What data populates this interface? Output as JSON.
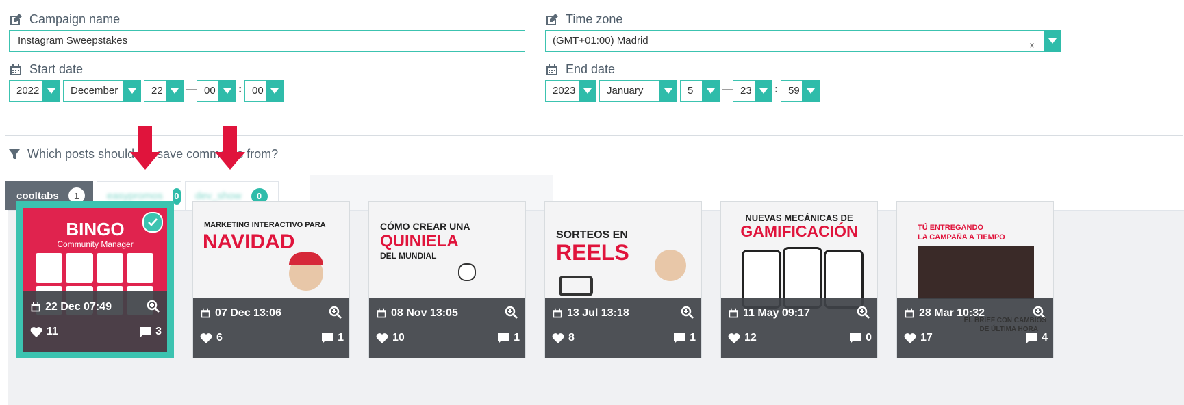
{
  "form": {
    "campaign_name": {
      "label": "Campaign name",
      "value": "Instagram Sweepstakes"
    },
    "time_zone": {
      "label": "Time zone",
      "value": "(GMT+01:00) Madrid",
      "clear": "×"
    },
    "start_date": {
      "label": "Start date",
      "year": "2022",
      "month": "December",
      "day": "22",
      "hour": "00",
      "minute": "00"
    },
    "end_date": {
      "label": "End date",
      "year": "2023",
      "month": "January",
      "day": "5",
      "hour": "23",
      "minute": "59"
    },
    "dash": "—",
    "colon": ":"
  },
  "posts_question": "Which posts should we save comments from?",
  "tabs": [
    {
      "label": "cooltabs",
      "count": "1",
      "active": true
    },
    {
      "label": "easypromos",
      "count": "0",
      "active": false
    },
    {
      "label": "dev_show",
      "count": "0",
      "active": false
    }
  ],
  "posts": [
    {
      "date": "22 Dec 07:49",
      "likes": "11",
      "comments": "3",
      "selected": true,
      "thumb": {
        "title": "BINGO",
        "subtitle": "Community Manager",
        "bg": "#e0234e"
      }
    },
    {
      "date": "07 Dec 13:06",
      "likes": "6",
      "comments": "1",
      "selected": false,
      "thumb": {
        "line1": "MARKETING INTERACTIVO PARA",
        "line2": "NAVIDAD"
      }
    },
    {
      "date": "08 Nov 13:05",
      "likes": "10",
      "comments": "1",
      "selected": false,
      "thumb": {
        "line1": "CÓMO CREAR UNA",
        "line2": "QUINIELA",
        "line3": "DEL MUNDIAL"
      }
    },
    {
      "date": "13 Jul 13:18",
      "likes": "8",
      "comments": "1",
      "selected": false,
      "thumb": {
        "line1": "SORTEOS EN",
        "line2": "REELS"
      }
    },
    {
      "date": "11 May 09:17",
      "likes": "12",
      "comments": "0",
      "selected": false,
      "thumb": {
        "line1": "NUEVAS MECÁNICAS DE",
        "line2": "GAMIFICACIÓN"
      }
    },
    {
      "date": "28 Mar 10:32",
      "likes": "17",
      "comments": "4",
      "selected": false,
      "thumb": {
        "line1": "TÚ ENTREGANDO",
        "line2": "LA CAMPAÑA A TIEMPO",
        "line3": "EL BRIEF CON CAMBIOS",
        "line4": "DE ÚLTIMA HORA"
      }
    }
  ],
  "colors": {
    "accent": "#2fbcaa",
    "arrow": "#e0143c",
    "tab_active": "#626b75"
  },
  "icons": [
    "edit-icon",
    "calendar-icon",
    "filter-icon",
    "zoom-icon",
    "heart-icon",
    "comment-icon",
    "check-icon"
  ]
}
